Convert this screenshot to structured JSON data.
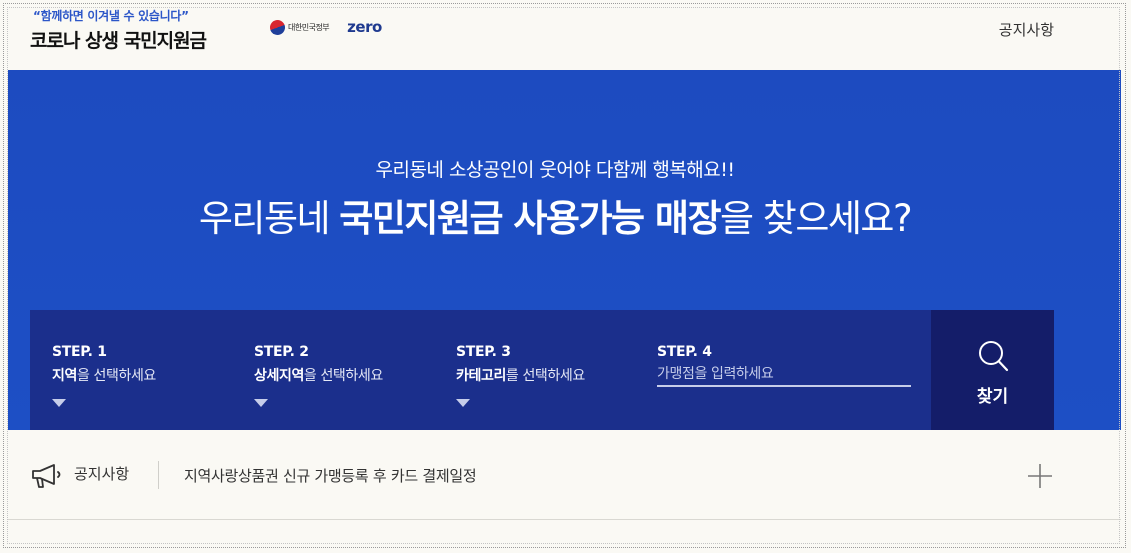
{
  "header": {
    "slogan": "“함께하면 이겨낼 수 있습니다”",
    "title": "코로나 상생 국민지원금",
    "gov_label": "대한민국정부",
    "zero_label": "zero",
    "notice_link": "공지사항"
  },
  "hero": {
    "subtitle": "우리동네 소상공인이 웃어야 다함께 행복해요!!",
    "title_pre": "우리동네 ",
    "title_bold1": "국민지원금 사용가능 매장",
    "title_post": "을 찾으세요?"
  },
  "steps": [
    {
      "num": "STEP. 1",
      "bold": "지역",
      "rest": "을 선택하세요"
    },
    {
      "num": "STEP. 2",
      "bold": "상세지역",
      "rest": "을 선택하세요"
    },
    {
      "num": "STEP. 3",
      "bold": "카테고리",
      "rest": "를 선택하세요"
    },
    {
      "num": "STEP. 4",
      "placeholder": "가맹점을 입력하세요",
      "value": ""
    }
  ],
  "find_button": {
    "label": "찾기",
    "icon": "search-icon"
  },
  "notice": {
    "label": "공지사항",
    "text": "지역사랑상품권 신규 가맹등록 후 카드 결제일정",
    "icon": "megaphone-icon",
    "more_icon": "plus-icon"
  },
  "colors": {
    "hero_blue": "#1d4fc5",
    "steps_navy": "#1b2f8c",
    "button_navy": "#141d69",
    "slogan_blue": "#2c56c8"
  }
}
